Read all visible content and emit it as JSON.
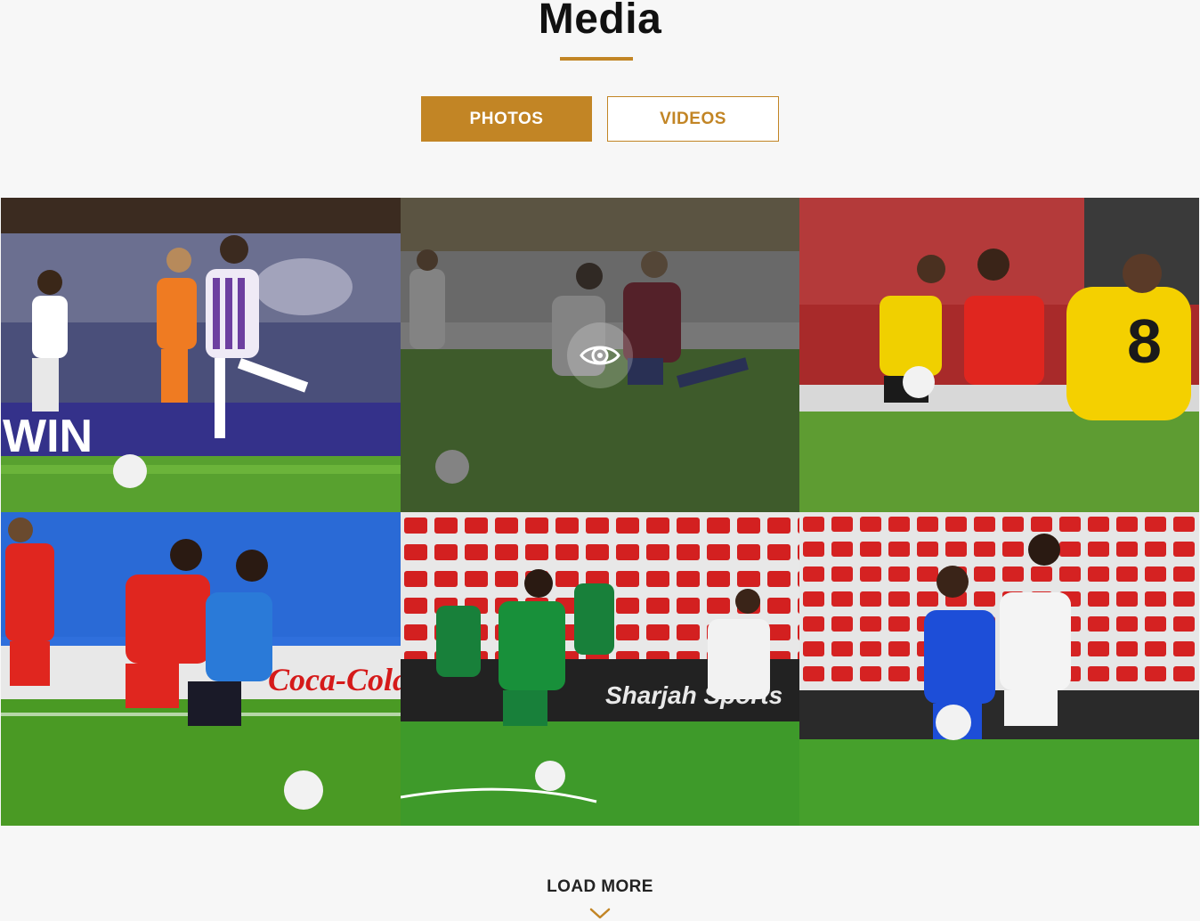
{
  "section": {
    "title": "Media"
  },
  "tabs": [
    {
      "label": "PHOTOS",
      "active": true
    },
    {
      "label": "VIDEOS",
      "active": false
    }
  ],
  "gallery": {
    "items": [
      {
        "name": "photo-1",
        "scene": "white-purple kit player dribbling vs orange kit"
      },
      {
        "name": "photo-2",
        "scene": "white kit vs maroon kit, hovered"
      },
      {
        "name": "photo-3",
        "scene": "yellow kit vs red kit challenge"
      },
      {
        "name": "photo-4",
        "scene": "red-black kit vs blue-white kit"
      },
      {
        "name": "photo-5",
        "scene": "green kit attacking, red stadium seats"
      },
      {
        "name": "photo-6",
        "scene": "blue kit vs white kit, red seats"
      }
    ],
    "hovered_index": 1,
    "hover_icon": "eye-icon"
  },
  "footer": {
    "load_more_label": "LOAD MORE",
    "load_more_icon": "chevron-down-icon"
  },
  "colors": {
    "accent": "#c28525",
    "background": "#f7f7f7",
    "text": "#111111"
  }
}
